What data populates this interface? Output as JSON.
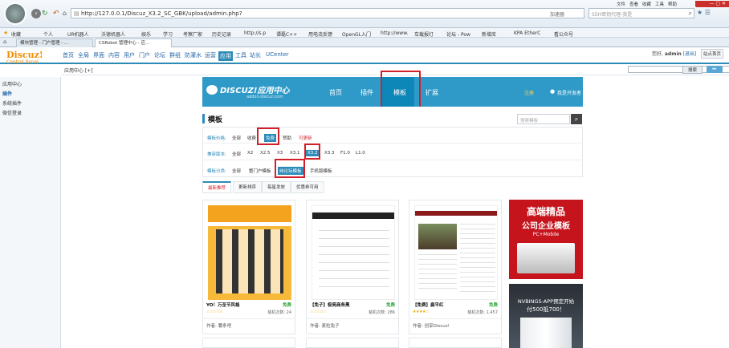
{
  "browser": {
    "url": "http://127.0.0.1/Discuz_X3.2_SC_GBK/upload/admin.php?",
    "url_hint": "加速器",
    "search_placeholder": "SSH密钥代理-我是",
    "menu": [
      "文件",
      "查看",
      "收藏",
      "工具",
      "帮助"
    ],
    "bookmarks": [
      "收藏",
      "个人",
      "UR机器人",
      "沃德机器人",
      "娱乐",
      "学习",
      "考察厂家",
      "历史记录",
      "http://s.p",
      "谭磊C++",
      "用电流反馈",
      "OpenGL入门",
      "http://www.",
      "车载报灯",
      "论坛 - Pow",
      "新增库",
      "KPA EtherC",
      "看公众号"
    ],
    "tabs": [
      "模块管理 - 门户管理 - ...",
      "CSRobot 管理中心 - 应..."
    ]
  },
  "discuz": {
    "logo": "Discuz!",
    "logo_sub": "Control Panel",
    "topnav": [
      "首页",
      "全局",
      "界面",
      "内容",
      "用户",
      "门户",
      "论坛",
      "群组",
      "防灌水",
      "运营",
      "应用",
      "工具",
      "站长",
      "UCenter"
    ],
    "active_topnav": "应用",
    "user_greeting": "您好,",
    "username": "admin",
    "logout": "[退出]",
    "site_home": "站点首页",
    "crumb": "应用中心 [+]",
    "search_button": "搜索",
    "side": [
      "应用中心",
      "插件",
      "系统插件",
      "微信登录"
    ]
  },
  "appcenter": {
    "logo": "DISCUZ!应用中心",
    "logo_sub": "addon.discuz.com",
    "nav": [
      "首页",
      "插件",
      "模板",
      "扩展"
    ],
    "active_nav": "模板",
    "login": "注册",
    "developer": "我是开发者",
    "section_title": "模板",
    "search_placeholder": "搜索模板",
    "filters": {
      "price_label": "模板价格:",
      "price": [
        "全部",
        "收费",
        "免费",
        "赞助",
        "可更新"
      ],
      "version_label": "兼容版本:",
      "version": [
        "全部",
        "X2",
        "X2.5",
        "X3",
        "X3.1",
        "X3.2",
        "X3.3",
        "F1.0",
        "L1.0"
      ],
      "type_label": "模板分类:",
      "type": [
        "全部",
        "整门户模板",
        "纯论坛模板",
        "手机版模板"
      ]
    },
    "sort": [
      "最新推荐",
      "更新排序",
      "每星发放",
      "优惠券可用"
    ],
    "cards": [
      {
        "title": "YO！万圣节风格",
        "badge": "免费",
        "stars": "☆☆☆☆☆",
        "downloads": "装机次数: 24",
        "author": "作者: 薯条吧"
      },
      {
        "title": "【免子】极简商务黑",
        "badge": "免费",
        "stars": "☆☆☆☆☆",
        "downloads": "装机次数: 286",
        "author": "作者: 麦粒兔子"
      },
      {
        "title": "【免费】扁平红",
        "badge": "免费",
        "stars": "★★★★☆",
        "downloads": "装机次数: 1,457",
        "author": "作者: 创享Discuz!"
      }
    ],
    "ad1": {
      "title1": "高端精品",
      "title2": "公司企业模板",
      "sub": "PC+Mobile"
    },
    "ad2": {
      "line1": "NVBINGS-APP预定开始",
      "line2": "付500抵700！"
    }
  }
}
